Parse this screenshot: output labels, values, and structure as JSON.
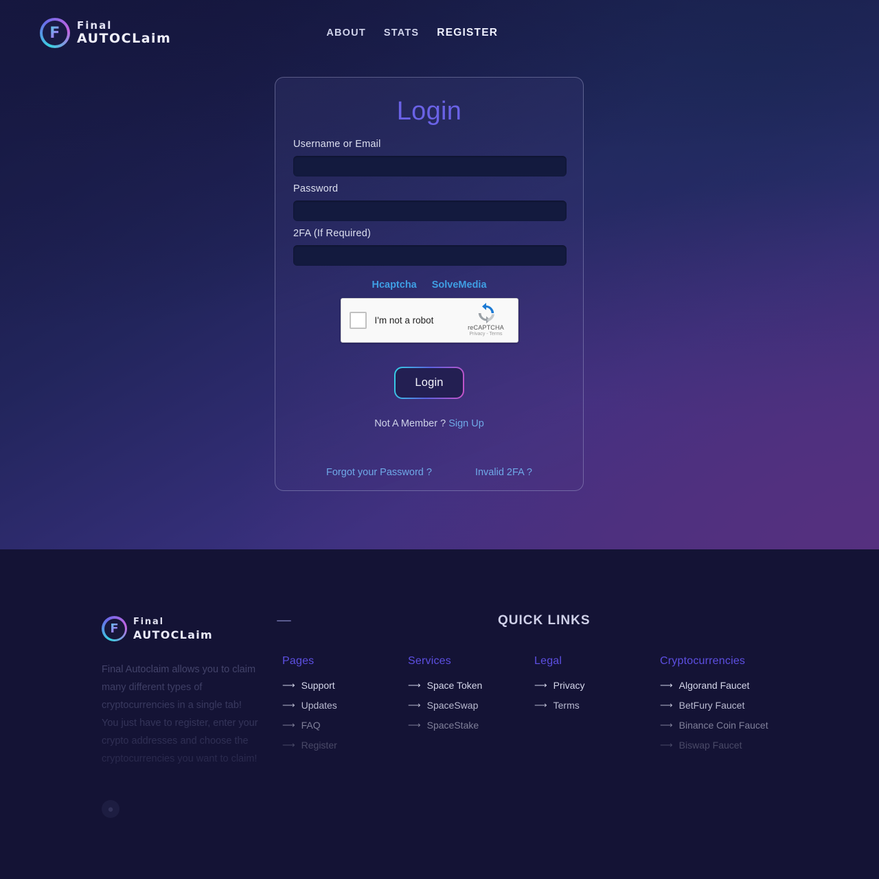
{
  "brand": {
    "logo_letter": "F",
    "line1": "Final",
    "line2": "AUTOCLaim"
  },
  "nav": {
    "items": [
      {
        "label": "ABOUT",
        "accent": false
      },
      {
        "label": "STATS",
        "accent": false
      },
      {
        "label": "REGISTER",
        "accent": true
      }
    ]
  },
  "login": {
    "title": "Login",
    "fields": [
      {
        "label": "Username or Email",
        "value": "",
        "placeholder": "",
        "type": "text",
        "name": "username-or-email"
      },
      {
        "label": "Password",
        "value": "",
        "placeholder": "",
        "type": "password",
        "name": "password"
      },
      {
        "label": "2FA (If Required)",
        "value": "",
        "placeholder": "",
        "type": "text",
        "name": "two-factor"
      }
    ],
    "captcha_options": [
      {
        "label": "Hcaptcha"
      },
      {
        "label": "SolveMedia"
      }
    ],
    "recaptcha": {
      "checkbox_label": "I'm not a robot",
      "brand_name": "reCAPTCHA",
      "legal": "Privacy - Terms"
    },
    "submit_label": "Login",
    "member_prompt": "Not A Member ?",
    "signup_label": "Sign Up",
    "forgot_password_label": "Forgot your Password ?",
    "invalid_2fa_label": "Invalid 2FA ?"
  },
  "footer": {
    "brand": {
      "logo_letter": "F",
      "line1": "Final",
      "line2": "AUTOCLaim"
    },
    "description": "Final Autoclaim allows you to claim many different types of cryptocurrencies in a single tab! You just have to register, enter your crypto addresses and choose the cryptocurrencies you want to claim!",
    "quick_links_title": "QUICK LINKS",
    "columns": [
      {
        "title": "Pages",
        "links": [
          {
            "label": "Support",
            "fade": 0
          },
          {
            "label": "Updates",
            "fade": 1
          },
          {
            "label": "FAQ",
            "fade": 2
          },
          {
            "label": "Register",
            "fade": 3
          }
        ]
      },
      {
        "title": "Services",
        "links": [
          {
            "label": "Space Token",
            "fade": 0
          },
          {
            "label": "SpaceSwap",
            "fade": 1
          },
          {
            "label": "SpaceStake",
            "fade": 2
          }
        ]
      },
      {
        "title": "Legal",
        "links": [
          {
            "label": "Privacy",
            "fade": 0
          },
          {
            "label": "Terms",
            "fade": 1
          }
        ]
      },
      {
        "title": "Cryptocurrencies",
        "links": [
          {
            "label": "Algorand Faucet",
            "fade": 0
          },
          {
            "label": "BetFury Faucet",
            "fade": 1
          },
          {
            "label": "Binance Coin Faucet",
            "fade": 2
          },
          {
            "label": "Biswap Faucet",
            "fade": 3
          }
        ]
      }
    ],
    "social": [
      {
        "name": "social-icon",
        "glyph": "●"
      }
    ]
  },
  "colors": {
    "accent_indigo": "#5d4fe2",
    "link_blue": "#6fa9e8",
    "captcha_blue": "#3f9fe4",
    "title_indigo": "#6a62e6",
    "footer_bg": "#141335"
  }
}
